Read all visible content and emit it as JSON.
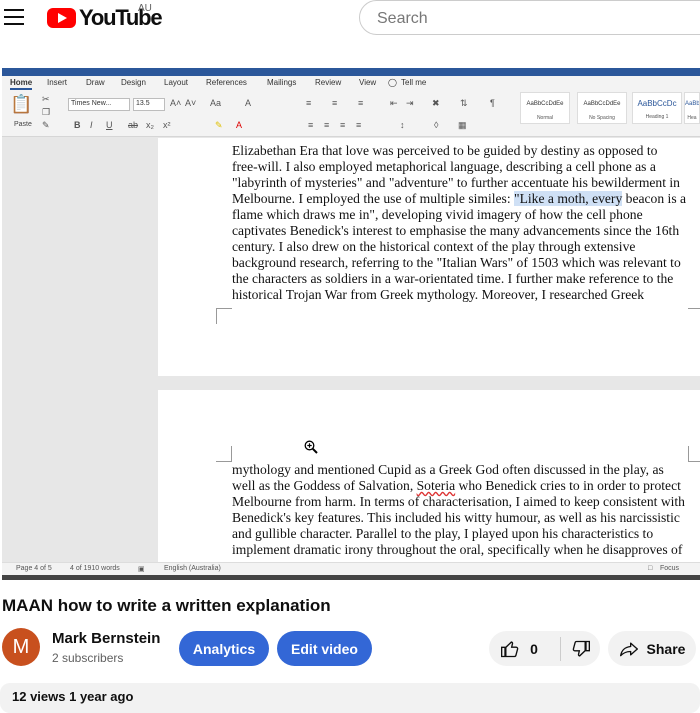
{
  "header": {
    "logo_text": "YouTube",
    "country": "AU",
    "search_placeholder": "Search"
  },
  "word": {
    "tabs": [
      "Home",
      "Insert",
      "Draw",
      "Design",
      "Layout",
      "References",
      "Mailings",
      "Review",
      "View",
      "Tell me"
    ],
    "font_name": "Times New...",
    "font_size": "13.5",
    "paste_label": "Paste",
    "styles": [
      {
        "preview": "AaBbCcDdEe",
        "name": "Normal"
      },
      {
        "preview": "AaBbCcDdEe",
        "name": "No Spacing"
      },
      {
        "preview": "AaBbCcDc",
        "name": "Heading 1"
      },
      {
        "preview": "AaBb",
        "name": "Hea"
      }
    ],
    "page1_lines": [
      "Elizabethan Era that love was perceived to be guided by destiny as opposed to",
      "free-will. I also employed metaphorical language, describing a cell phone as a",
      "\"labyrinth of mysteries\" and \"adventure\" to further accentuate his bewilderment in",
      "Melbourne. I employed the use of multiple similes: ",
      "flame which draws me in\", developing vivid imagery of how the cell phone",
      "captivates Benedick's interest to emphasise the many advancements since the 16th",
      "century. I also drew on the historical context of the play through extensive",
      "background research, referring to the \"Italian Wars\" of 1503 which was relevant to",
      "the characters as soldiers in a war-orientated time. I further make reference to the",
      "historical Trojan War from Greek mythology. Moreover, I researched Greek"
    ],
    "highlight": "\"Like a moth, every",
    "highlight_tail": " beacon is a",
    "page2_lines": [
      "mythology and mentioned Cupid as a Greek God often discussed in the play, as",
      "well as the Goddess of Salvation, ",
      "Melbourne from harm. In terms of characterisation, I aimed to keep consistent with",
      "Benedick's key features. This included his witty humour, as well as his narcissistic",
      "and gullible character. Parallel to the play, I played upon his characteristics to",
      "implement dramatic irony throughout the oral, specifically when he disapproves of"
    ],
    "soteria": "Soteria",
    "line2_tail": " who Benedick cries to in order to protect",
    "status": {
      "page": "Page 4 of 5",
      "words": "4 of 1910 words",
      "language": "English (Australia)",
      "focus": "Focus"
    }
  },
  "video": {
    "title": "MAAN how to write a written explanation"
  },
  "channel": {
    "avatar_letter": "M",
    "name": "Mark Bernstein",
    "subscribers": "2 subscribers"
  },
  "actions": {
    "analytics": "Analytics",
    "edit_video": "Edit video",
    "likes": "0",
    "share": "Share"
  },
  "meta": {
    "views": "12 views  1 year ago"
  }
}
